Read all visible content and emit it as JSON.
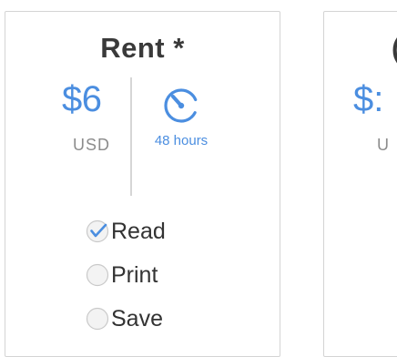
{
  "rent_card": {
    "title": "Rent *",
    "price": "$6",
    "currency": "USD",
    "duration": "48 hours",
    "icon": "timer-icon",
    "options": [
      {
        "label": "Read",
        "checked": true
      },
      {
        "label": "Print",
        "checked": false
      },
      {
        "label": "Save",
        "checked": false
      }
    ]
  },
  "second_card": {
    "title_partial": "(",
    "price_partial": "$:",
    "currency_partial": "U"
  },
  "colors": {
    "accent": "#4b8ee0",
    "border": "#d4d4d4",
    "text": "#333333",
    "muted": "#8c8c8c"
  }
}
